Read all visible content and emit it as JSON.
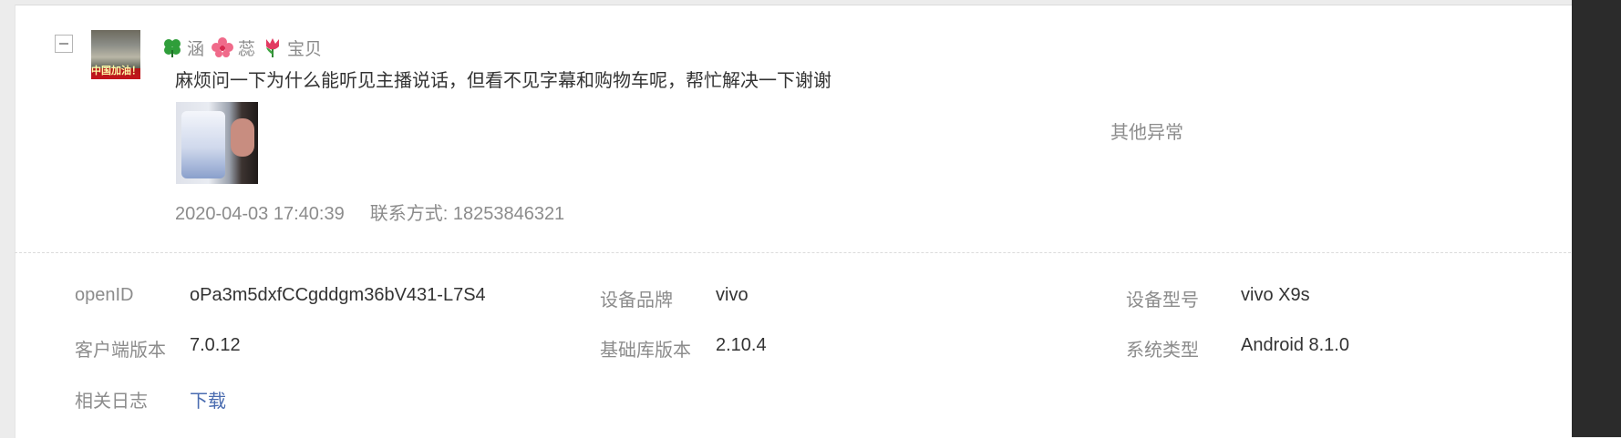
{
  "author": {
    "nickname_parts": [
      "涵",
      "蕊",
      "宝贝"
    ],
    "emoji_icons": [
      "clover-icon",
      "hibiscus-icon",
      "tulip-icon"
    ],
    "avatar_caption": "中国加油！"
  },
  "message": {
    "text": "麻烦问一下为什么能听见主播说话，但看不见字幕和购物车呢，帮忙解决一下谢谢",
    "timestamp": "2020-04-03 17:40:39",
    "contact": "联系方式: 18253846321",
    "category": "其他异常"
  },
  "details": {
    "openid_label": "openID",
    "openid_value": "oPa3m5dxfCCgddgm36bV431-L7S4",
    "brand_label": "设备品牌",
    "brand_value": "vivo",
    "model_label": "设备型号",
    "model_value": "vivo X9s",
    "client_label": "客户端版本",
    "client_value": "7.0.12",
    "lib_label": "基础库版本",
    "lib_value": "2.10.4",
    "os_label": "系统类型",
    "os_value": "Android 8.1.0",
    "log_label": "相关日志",
    "log_link": "下载"
  },
  "colors": {
    "link": "#4a6cb0",
    "muted_text": "#8c8c8c",
    "body_text": "#333333"
  }
}
